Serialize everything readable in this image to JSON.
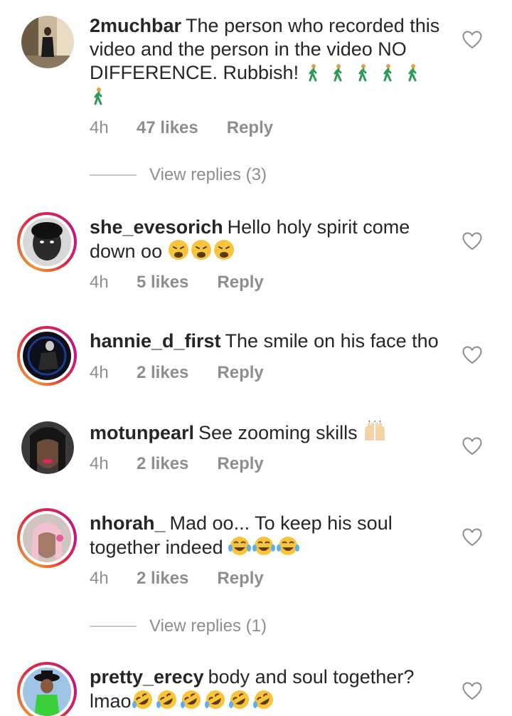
{
  "comments": [
    {
      "username": "2muchbar",
      "text": "The person who recorded this video and the person in the video NO DIFFERENCE. Rubbish!",
      "emoji": "walking-person",
      "emoji_count": 6,
      "time": "4h",
      "likes": "47 likes",
      "reply": "Reply",
      "story_ring": false,
      "view_replies": "View replies (3)"
    },
    {
      "username": "she_evesorich",
      "text": "Hello holy spirit come down oo",
      "emoji": "weary-face",
      "emoji_count": 3,
      "time": "4h",
      "likes": "5 likes",
      "reply": "Reply",
      "story_ring": true
    },
    {
      "username": "hannie_d_first",
      "text": "The smile on his face tho",
      "time": "4h",
      "likes": "2 likes",
      "reply": "Reply",
      "story_ring": true
    },
    {
      "username": "motunpearl",
      "text": "See zooming skills",
      "emoji": "raising-hands",
      "emoji_count": 1,
      "time": "4h",
      "likes": "2 likes",
      "reply": "Reply",
      "story_ring": false
    },
    {
      "username": "nhorah_",
      "text": "Mad oo... To keep his soul together indeed",
      "emoji": "tears-of-joy",
      "emoji_count": 3,
      "time": "4h",
      "likes": "2 likes",
      "reply": "Reply",
      "story_ring": true,
      "view_replies": "View replies (1)"
    },
    {
      "username": "pretty_erecy",
      "text": "body and soul together? lmao",
      "emoji": "rolling-on-floor-laughing",
      "emoji_count": 6,
      "story_ring": true
    }
  ],
  "colors": {
    "text": "#262626",
    "secondary": "#8e8e8e",
    "divider": "#c7c7c7"
  }
}
